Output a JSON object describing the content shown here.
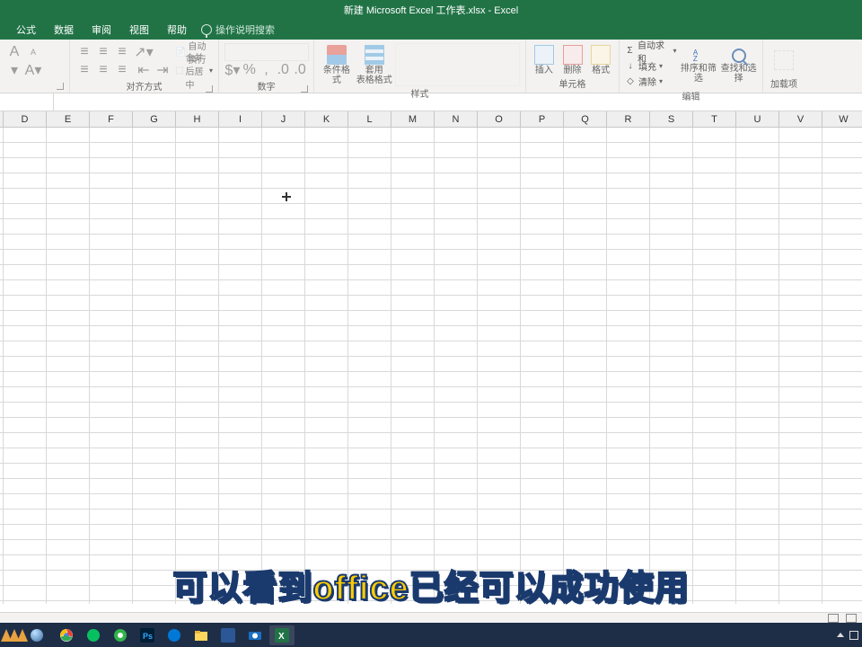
{
  "title": "新建 Microsoft Excel 工作表.xlsx - Excel",
  "tabs": [
    "公式",
    "数据",
    "审阅",
    "视图",
    "帮助"
  ],
  "tell_me": "操作说明搜索",
  "groups": {
    "alignment": {
      "wrap": "自动换行",
      "merge": "合并后居中",
      "label": "对齐方式"
    },
    "number": {
      "label": "数字"
    },
    "styles": {
      "cond_fmt": "条件格式",
      "fmt_table": "套用\n表格格式",
      "label": "样式"
    },
    "cells": {
      "insert": "插入",
      "delete": "删除",
      "format": "格式",
      "label": "单元格"
    },
    "editing": {
      "autosum": "自动求和",
      "fill": "填充",
      "clear": "清除",
      "sort": "排序和筛选",
      "find": "查找和选择",
      "label": "编辑"
    },
    "addins": {
      "label": "加载项"
    }
  },
  "columns": [
    "D",
    "E",
    "F",
    "G",
    "H",
    "I",
    "J",
    "K",
    "L",
    "M",
    "N",
    "O",
    "P",
    "Q",
    "R",
    "S",
    "T",
    "U",
    "V",
    "W"
  ],
  "subtitle": "可以看到office已经可以成功使用",
  "taskbar": {
    "icons": [
      "chrome",
      "wechat",
      "360",
      "photoshop",
      "edge",
      "explorer",
      "paint",
      "camera",
      "excel"
    ]
  }
}
